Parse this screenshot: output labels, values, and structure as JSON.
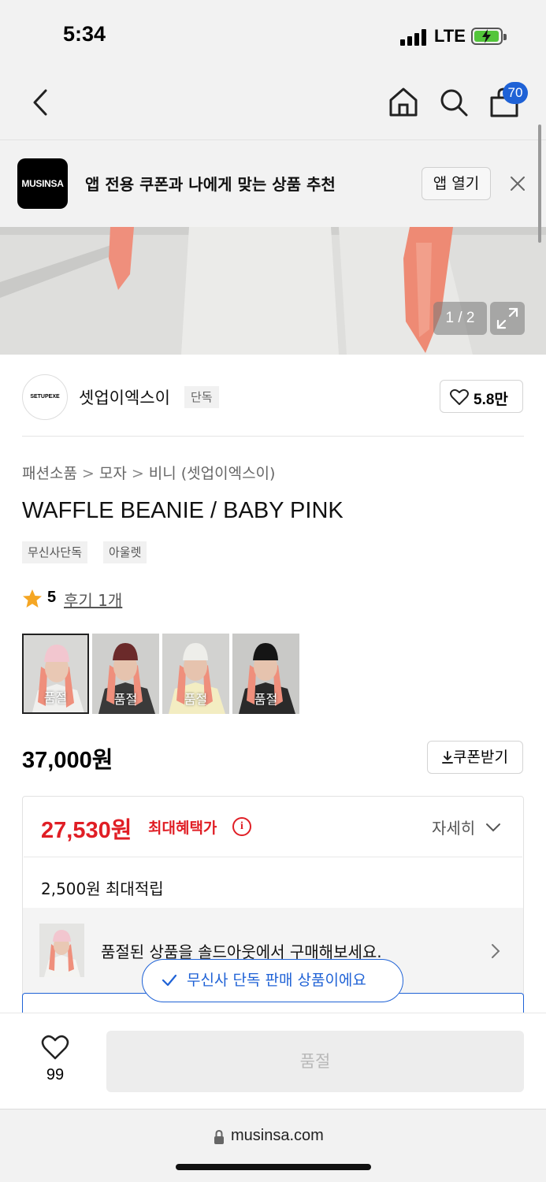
{
  "status_bar": {
    "time": "5:34",
    "network": "LTE"
  },
  "nav": {
    "cart_count": "70"
  },
  "app_banner": {
    "logo_text": "MUSINSA",
    "message": "앱 전용 쿠폰과 나에게 맞는 상품 추천",
    "open_label": "앱 열기"
  },
  "hero": {
    "counter": "1 / 2"
  },
  "brand": {
    "logo_text": "SETUPEXE",
    "name": "셋업이엑스이",
    "tag": "단독",
    "like_count": "5.8만"
  },
  "breadcrumb": [
    "패션소품",
    "모자",
    "비니 (셋업이엑스이)"
  ],
  "product": {
    "title": "WAFFLE BEANIE / BABY PINK",
    "tags": [
      "무신사단독",
      "아울렛"
    ],
    "rating": "5",
    "review_link": "후기 1개",
    "variants": [
      {
        "label": "품절",
        "beanie_color": "#f2c6cf"
      },
      {
        "label": "품절",
        "beanie_color": "#6b2a2a"
      },
      {
        "label": "품절",
        "beanie_color": "#eeeeea"
      },
      {
        "label": "품절",
        "beanie_color": "#151515"
      }
    ],
    "price": "37,000원",
    "coupon_label": "쿠폰받기"
  },
  "benefits": {
    "max_price": "27,530원",
    "max_label": "최대혜택가",
    "detail_label": "자세히",
    "points": "2,500원 최대적립",
    "soldout_message": "품절된 상품을 솔드아웃에서 구매해보세요.",
    "exclusive_message": "무신사 단독 판매 상품이에요"
  },
  "bottom": {
    "wish_count": "99",
    "buy_label": "품절"
  },
  "browser": {
    "url": "musinsa.com"
  },
  "colors": {
    "accent": "#1f62d6",
    "sale": "#e01e25",
    "star": "#f5a623"
  }
}
